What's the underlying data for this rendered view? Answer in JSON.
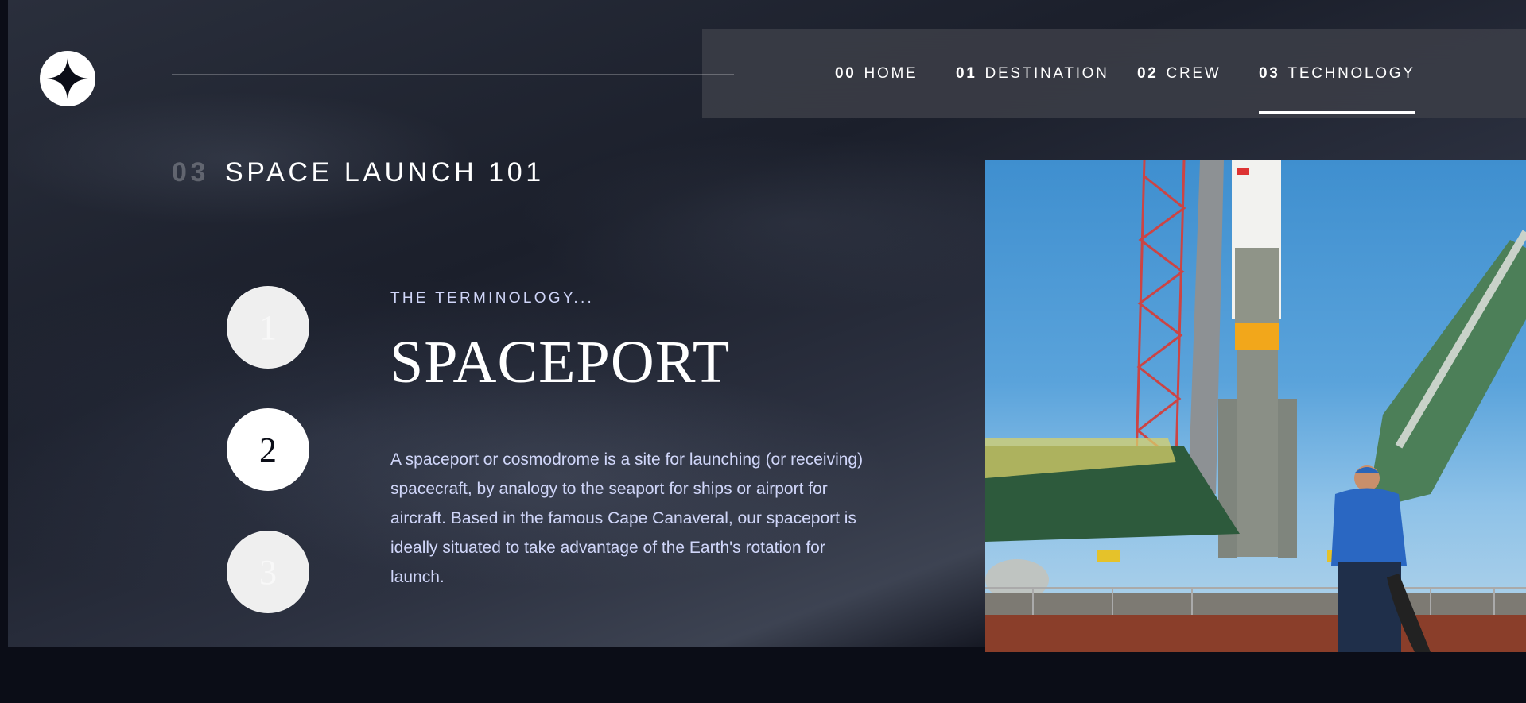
{
  "logo": {
    "icon": "star-logo-icon"
  },
  "nav": {
    "items": [
      {
        "num": "00",
        "label": "HOME",
        "active": false
      },
      {
        "num": "01",
        "label": "DESTINATION",
        "active": false
      },
      {
        "num": "02",
        "label": "CREW",
        "active": false
      },
      {
        "num": "03",
        "label": "TECHNOLOGY",
        "active": true
      }
    ]
  },
  "page": {
    "heading_num": "03",
    "heading_text": "SPACE LAUNCH 101"
  },
  "steps": [
    {
      "label": "1",
      "active": false
    },
    {
      "label": "2",
      "active": true
    },
    {
      "label": "3",
      "active": false
    }
  ],
  "content": {
    "kicker": "THE TERMINOLOGY...",
    "title": "SPACEPORT",
    "description": "A spaceport or cosmodrome is a site for launching (or receiving) spacecraft, by analogy to the seaport for ships or airport for aircraft. Based in the famous Cape Canaveral, our spaceport is ideally situated to take advantage of the Earth's rotation for launch."
  },
  "image": {
    "subject": "spaceport-rocket-photo"
  },
  "colors": {
    "background": "#0b0d17",
    "accent_text": "#d0d6f9",
    "white": "#ffffff"
  }
}
